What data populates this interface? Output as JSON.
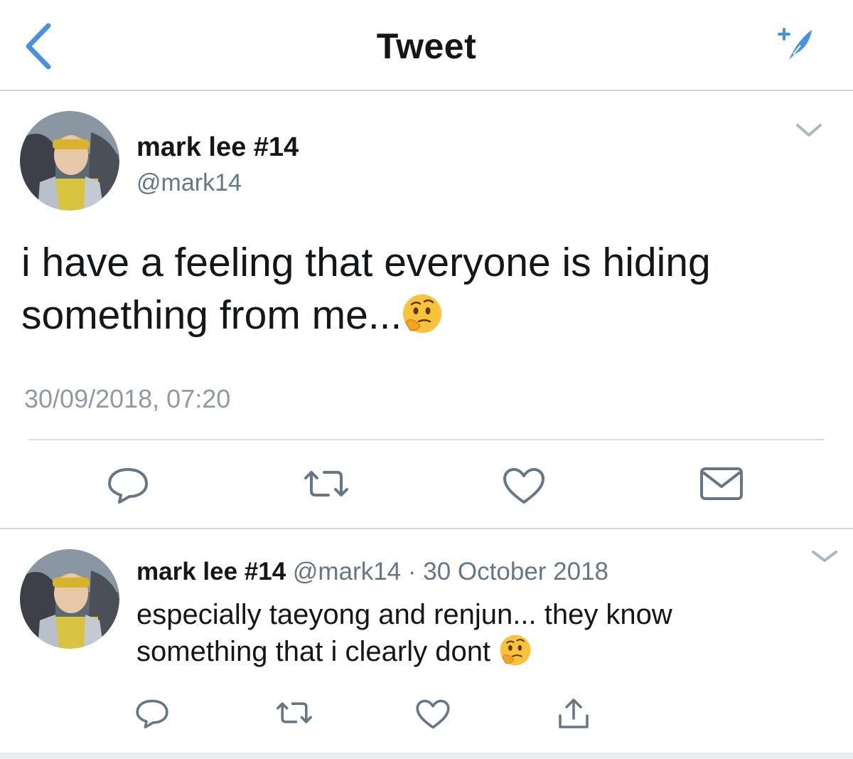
{
  "header": {
    "title": "Tweet",
    "back_icon": "chevron-left-icon",
    "compose_icon": "compose-tweet-icon"
  },
  "main_tweet": {
    "author_name": "mark lee #14",
    "author_handle": "@mark14",
    "text": "i have a feeling that everyone is hiding something from me...",
    "emoji": "thinking-face",
    "timestamp": "30/09/2018, 07:20",
    "actions": [
      "reply-icon",
      "retweet-icon",
      "like-icon",
      "direct-message-icon"
    ]
  },
  "reply_tweet": {
    "author_name": "mark lee #14",
    "author_handle": "@mark14",
    "separator": "·",
    "date": "30 October 2018",
    "text_line1": "especially taeyong and renjun... they know",
    "text_line2": "something that i clearly dont",
    "emoji": "thinking-face",
    "actions": [
      "reply-icon",
      "retweet-icon",
      "like-icon",
      "share-icon"
    ]
  },
  "colors": {
    "accent": "#4a90e2",
    "text_primary": "#14171a",
    "text_secondary": "#657786",
    "icon_gray": "#657786",
    "divider": "#d2d6da"
  }
}
